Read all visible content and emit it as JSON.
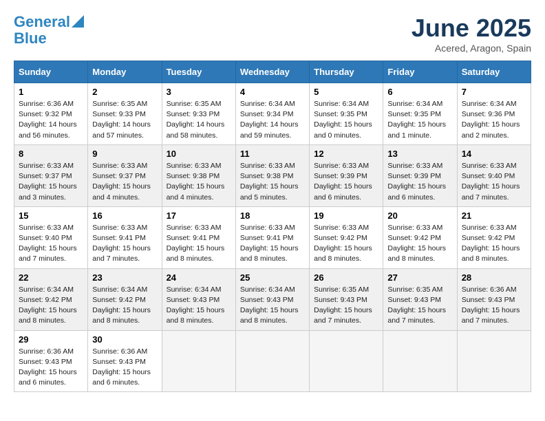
{
  "logo": {
    "line1": "General",
    "line2": "Blue"
  },
  "title": "June 2025",
  "subtitle": "Acered, Aragon, Spain",
  "days_of_week": [
    "Sunday",
    "Monday",
    "Tuesday",
    "Wednesday",
    "Thursday",
    "Friday",
    "Saturday"
  ],
  "weeks": [
    [
      {
        "day": "1",
        "info": "Sunrise: 6:36 AM\nSunset: 9:32 PM\nDaylight: 14 hours\nand 56 minutes."
      },
      {
        "day": "2",
        "info": "Sunrise: 6:35 AM\nSunset: 9:33 PM\nDaylight: 14 hours\nand 57 minutes."
      },
      {
        "day": "3",
        "info": "Sunrise: 6:35 AM\nSunset: 9:33 PM\nDaylight: 14 hours\nand 58 minutes."
      },
      {
        "day": "4",
        "info": "Sunrise: 6:34 AM\nSunset: 9:34 PM\nDaylight: 14 hours\nand 59 minutes."
      },
      {
        "day": "5",
        "info": "Sunrise: 6:34 AM\nSunset: 9:35 PM\nDaylight: 15 hours\nand 0 minutes."
      },
      {
        "day": "6",
        "info": "Sunrise: 6:34 AM\nSunset: 9:35 PM\nDaylight: 15 hours\nand 1 minute."
      },
      {
        "day": "7",
        "info": "Sunrise: 6:34 AM\nSunset: 9:36 PM\nDaylight: 15 hours\nand 2 minutes."
      }
    ],
    [
      {
        "day": "8",
        "info": "Sunrise: 6:33 AM\nSunset: 9:37 PM\nDaylight: 15 hours\nand 3 minutes."
      },
      {
        "day": "9",
        "info": "Sunrise: 6:33 AM\nSunset: 9:37 PM\nDaylight: 15 hours\nand 4 minutes."
      },
      {
        "day": "10",
        "info": "Sunrise: 6:33 AM\nSunset: 9:38 PM\nDaylight: 15 hours\nand 4 minutes."
      },
      {
        "day": "11",
        "info": "Sunrise: 6:33 AM\nSunset: 9:38 PM\nDaylight: 15 hours\nand 5 minutes."
      },
      {
        "day": "12",
        "info": "Sunrise: 6:33 AM\nSunset: 9:39 PM\nDaylight: 15 hours\nand 6 minutes."
      },
      {
        "day": "13",
        "info": "Sunrise: 6:33 AM\nSunset: 9:39 PM\nDaylight: 15 hours\nand 6 minutes."
      },
      {
        "day": "14",
        "info": "Sunrise: 6:33 AM\nSunset: 9:40 PM\nDaylight: 15 hours\nand 7 minutes."
      }
    ],
    [
      {
        "day": "15",
        "info": "Sunrise: 6:33 AM\nSunset: 9:40 PM\nDaylight: 15 hours\nand 7 minutes."
      },
      {
        "day": "16",
        "info": "Sunrise: 6:33 AM\nSunset: 9:41 PM\nDaylight: 15 hours\nand 7 minutes."
      },
      {
        "day": "17",
        "info": "Sunrise: 6:33 AM\nSunset: 9:41 PM\nDaylight: 15 hours\nand 8 minutes."
      },
      {
        "day": "18",
        "info": "Sunrise: 6:33 AM\nSunset: 9:41 PM\nDaylight: 15 hours\nand 8 minutes."
      },
      {
        "day": "19",
        "info": "Sunrise: 6:33 AM\nSunset: 9:42 PM\nDaylight: 15 hours\nand 8 minutes."
      },
      {
        "day": "20",
        "info": "Sunrise: 6:33 AM\nSunset: 9:42 PM\nDaylight: 15 hours\nand 8 minutes."
      },
      {
        "day": "21",
        "info": "Sunrise: 6:33 AM\nSunset: 9:42 PM\nDaylight: 15 hours\nand 8 minutes."
      }
    ],
    [
      {
        "day": "22",
        "info": "Sunrise: 6:34 AM\nSunset: 9:42 PM\nDaylight: 15 hours\nand 8 minutes."
      },
      {
        "day": "23",
        "info": "Sunrise: 6:34 AM\nSunset: 9:42 PM\nDaylight: 15 hours\nand 8 minutes."
      },
      {
        "day": "24",
        "info": "Sunrise: 6:34 AM\nSunset: 9:43 PM\nDaylight: 15 hours\nand 8 minutes."
      },
      {
        "day": "25",
        "info": "Sunrise: 6:34 AM\nSunset: 9:43 PM\nDaylight: 15 hours\nand 8 minutes."
      },
      {
        "day": "26",
        "info": "Sunrise: 6:35 AM\nSunset: 9:43 PM\nDaylight: 15 hours\nand 7 minutes."
      },
      {
        "day": "27",
        "info": "Sunrise: 6:35 AM\nSunset: 9:43 PM\nDaylight: 15 hours\nand 7 minutes."
      },
      {
        "day": "28",
        "info": "Sunrise: 6:36 AM\nSunset: 9:43 PM\nDaylight: 15 hours\nand 7 minutes."
      }
    ],
    [
      {
        "day": "29",
        "info": "Sunrise: 6:36 AM\nSunset: 9:43 PM\nDaylight: 15 hours\nand 6 minutes."
      },
      {
        "day": "30",
        "info": "Sunrise: 6:36 AM\nSunset: 9:43 PM\nDaylight: 15 hours\nand 6 minutes."
      },
      {
        "day": "",
        "info": ""
      },
      {
        "day": "",
        "info": ""
      },
      {
        "day": "",
        "info": ""
      },
      {
        "day": "",
        "info": ""
      },
      {
        "day": "",
        "info": ""
      }
    ]
  ]
}
